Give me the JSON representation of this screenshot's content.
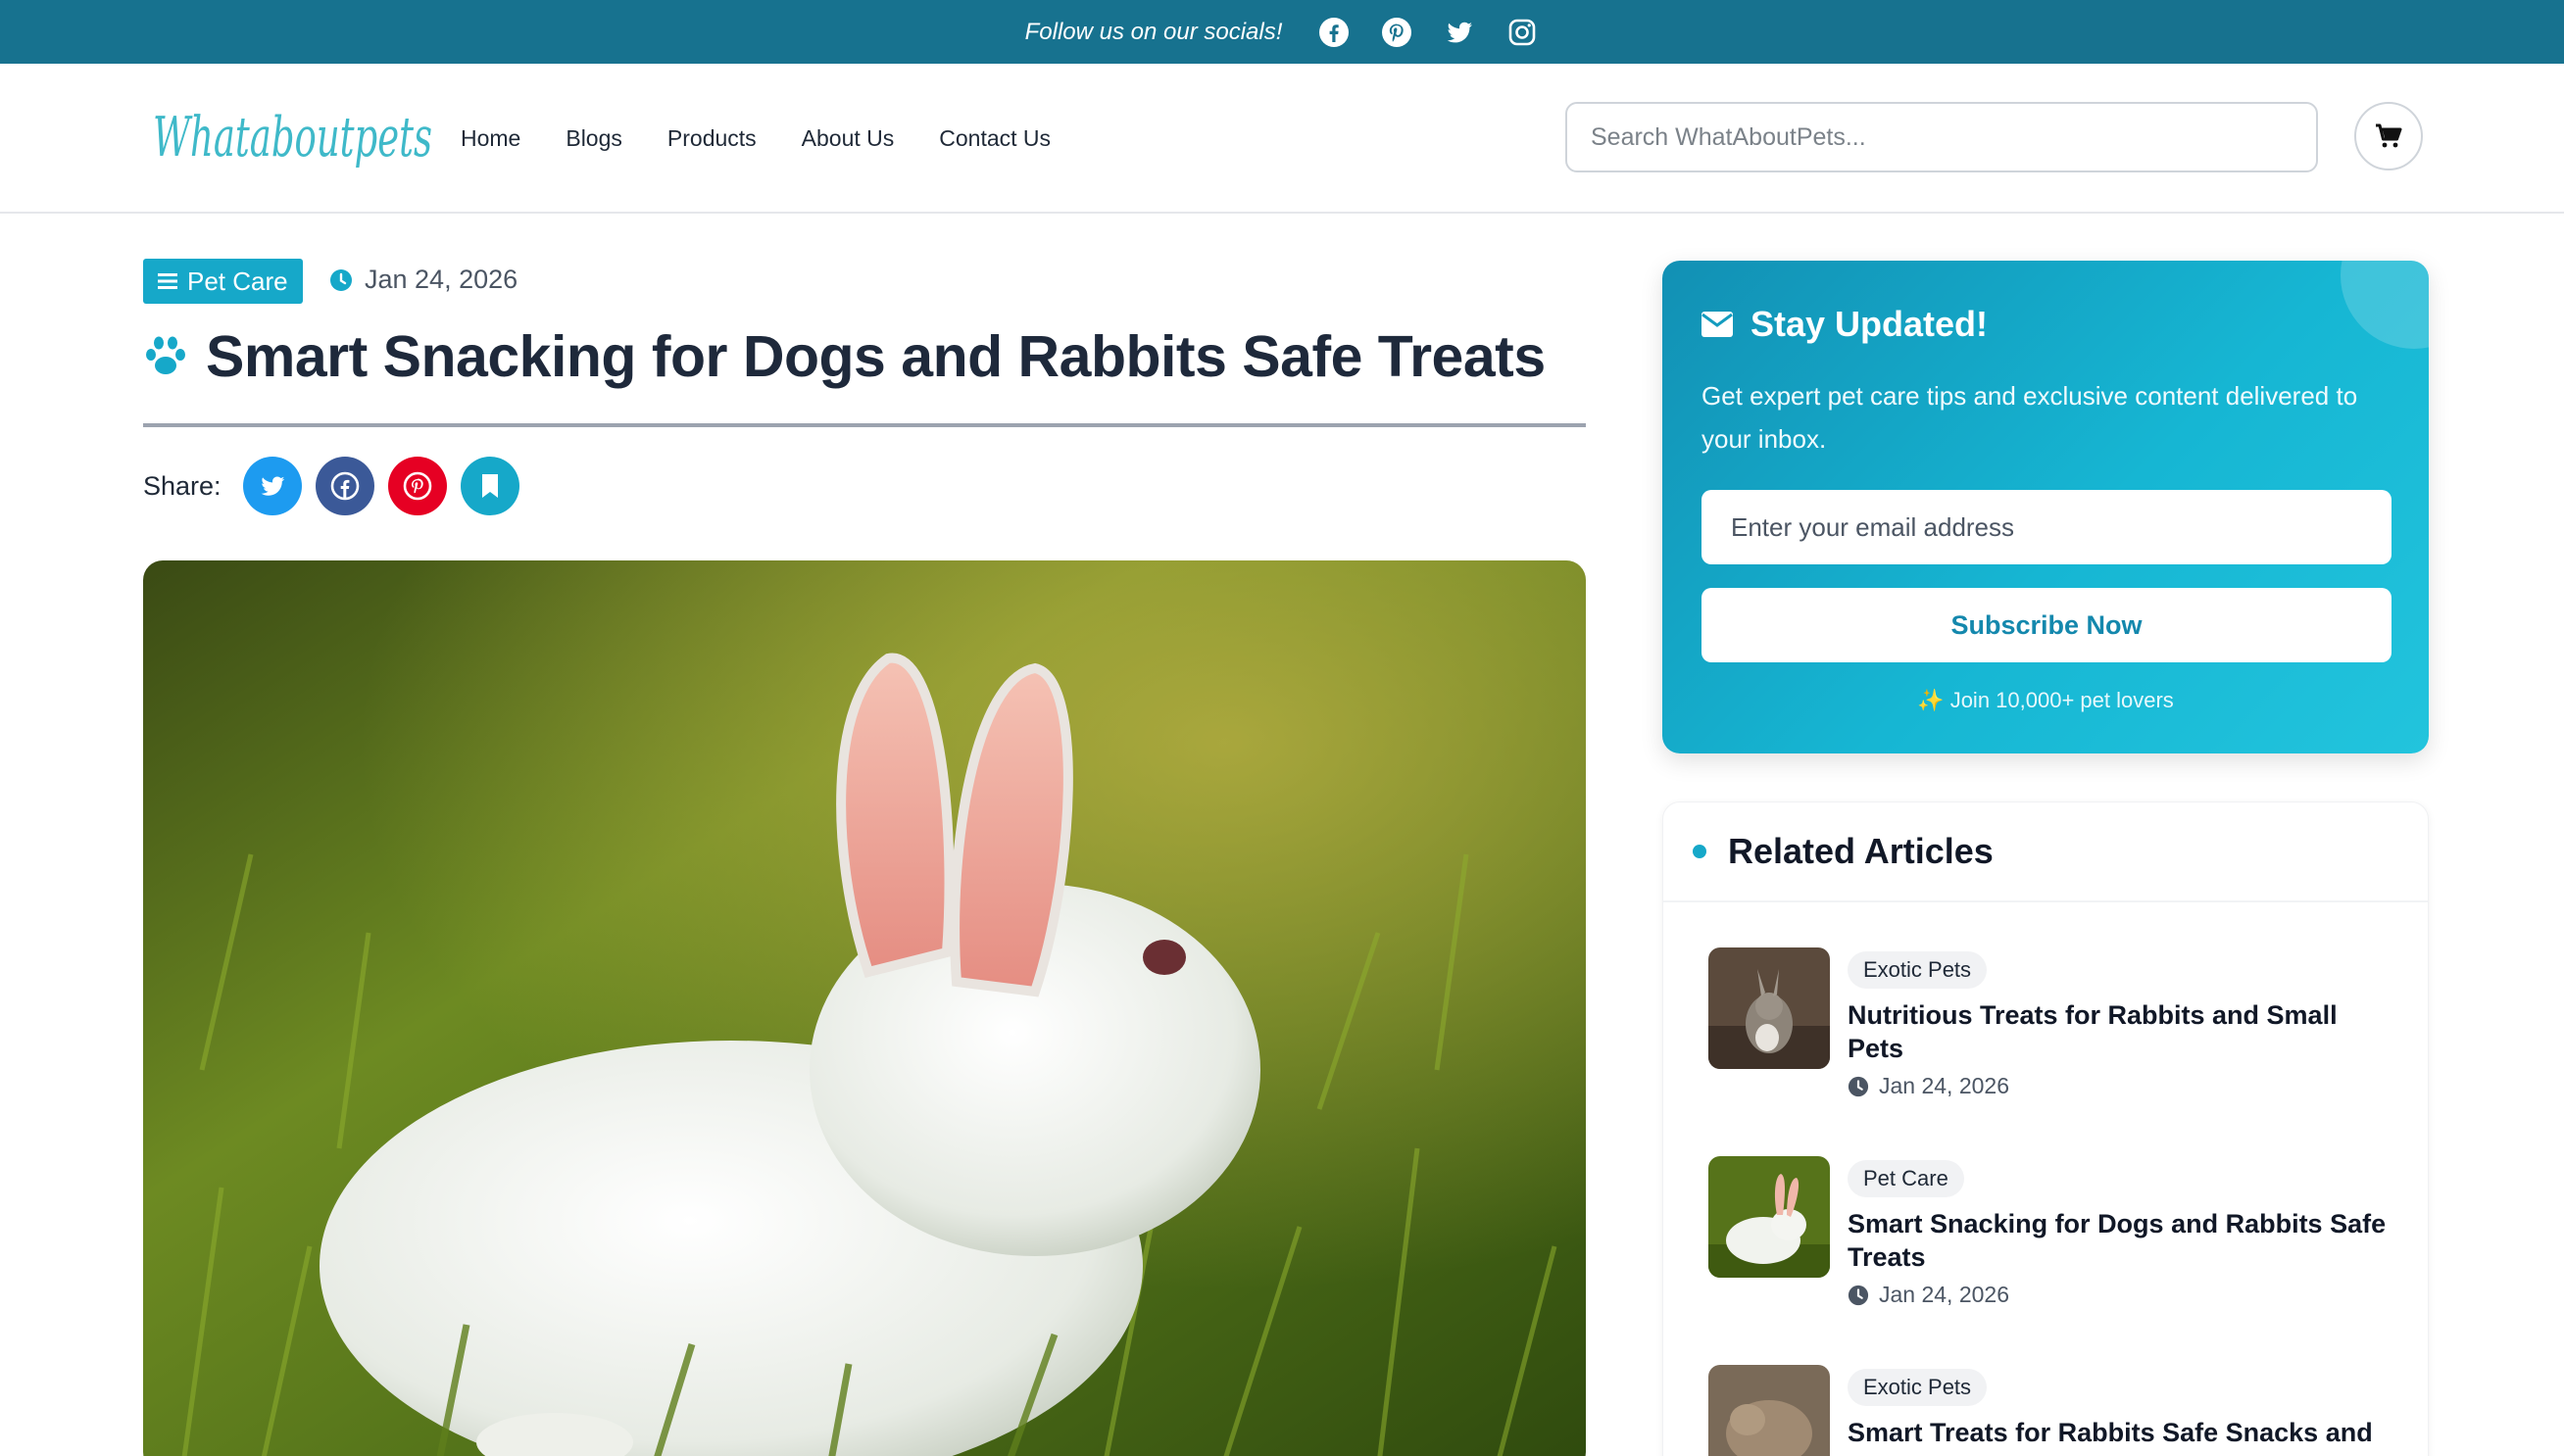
{
  "topbar": {
    "text": "Follow us on our socials!",
    "icons": [
      "facebook-icon",
      "pinterest-icon",
      "twitter-icon",
      "instagram-icon"
    ],
    "bg_color": "#17728f"
  },
  "header": {
    "logo_text": "Whataboutpets",
    "nav": [
      "Home",
      "Blogs",
      "Products",
      "About Us",
      "Contact Us"
    ],
    "search_placeholder": "Search WhatAboutPets...",
    "cart_icon": "cart-icon"
  },
  "article": {
    "category": "Pet Care",
    "date": "Jan 24, 2026",
    "title": "Smart Snacking for Dogs and Rabbits Safe Treats",
    "share_label": "Share:",
    "share_buttons": [
      {
        "icon": "twitter-icon",
        "color": "#1d9bf0"
      },
      {
        "icon": "facebook-icon",
        "color": "#3b5998"
      },
      {
        "icon": "pinterest-icon",
        "color": "#e60023"
      },
      {
        "icon": "bookmark-icon",
        "color": "#16a8c9"
      }
    ],
    "accent_color": "#16a8c9"
  },
  "newsletter": {
    "title": "Stay Updated!",
    "description": "Get expert pet care tips and exclusive content delivered to your inbox.",
    "email_placeholder": "Enter your email address",
    "button_label": "Subscribe Now",
    "footnote": "✨ Join 10,000+ pet lovers"
  },
  "related": {
    "heading": "Related Articles",
    "items": [
      {
        "category": "Exotic Pets",
        "title": "Nutritious Treats for Rabbits and Small Pets",
        "date": "Jan 24, 2026"
      },
      {
        "category": "Pet Care",
        "title": "Smart Snacking for Dogs and Rabbits Safe Treats",
        "date": "Jan 24, 2026"
      },
      {
        "category": "Exotic Pets",
        "title": "Smart Treats for Rabbits Safe Snacks and",
        "date": ""
      }
    ]
  }
}
